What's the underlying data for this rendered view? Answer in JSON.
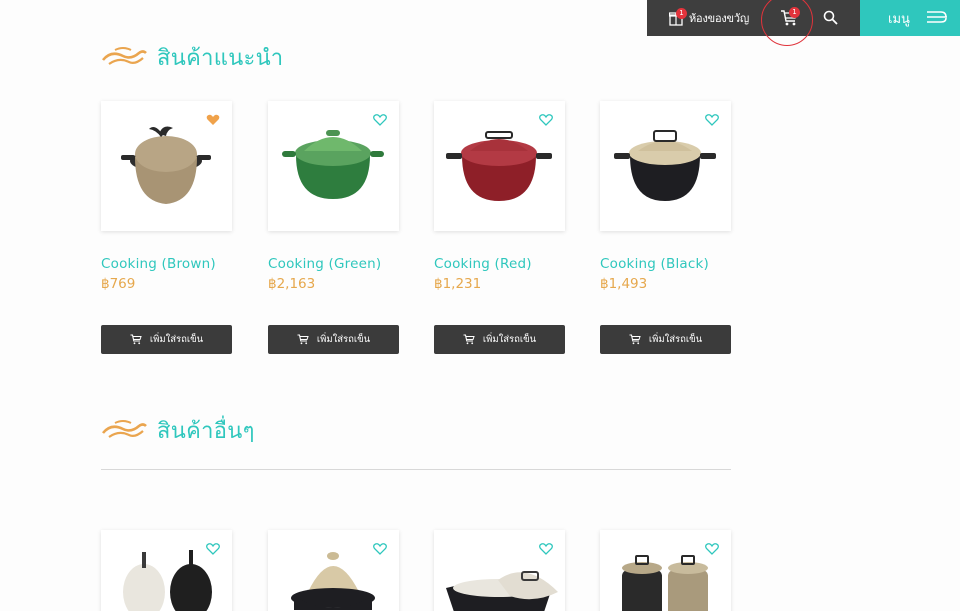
{
  "topbar": {
    "gift_label": "ห้องของขวัญ",
    "gift_badge": "1",
    "cart_badge": "1",
    "menu_label": "เมนู"
  },
  "sections": {
    "recommended_title": "สินค้าแนะนำ",
    "others_title": "สินค้าอื่นๆ"
  },
  "products": [
    {
      "name": "Cooking (Brown)",
      "price": "฿769",
      "button": "เพิ่มใส่รถเข็น",
      "favorited": true
    },
    {
      "name": "Cooking (Green)",
      "price": "฿2,163",
      "button": "เพิ่มใส่รถเข็น",
      "favorited": false
    },
    {
      "name": "Cooking (Red)",
      "price": "฿1,231",
      "button": "เพิ่มใส่รถเข็น",
      "favorited": false
    },
    {
      "name": "Cooking (Black)",
      "price": "฿1,493",
      "button": "เพิ่มใส่รถเข็น",
      "favorited": false
    }
  ],
  "icons": [
    "gift-icon",
    "cart-icon",
    "search-icon",
    "menu-icon",
    "heart-icon",
    "logo-icon"
  ],
  "colors": {
    "accent": "#2fc7bd",
    "price": "#e6a84d",
    "dark": "#3e3e3e",
    "badge": "#e2343c",
    "heart_filled": "#f0a24a"
  }
}
